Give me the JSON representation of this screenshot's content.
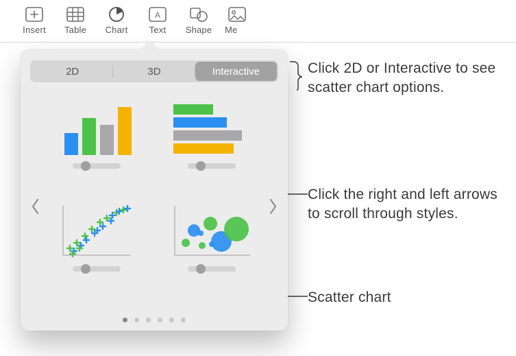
{
  "toolbar": {
    "items": [
      {
        "label": "Insert"
      },
      {
        "label": "Table"
      },
      {
        "label": "Chart"
      },
      {
        "label": "Text"
      },
      {
        "label": "Shape"
      },
      {
        "label": "Me"
      }
    ]
  },
  "popover": {
    "tabs": [
      "2D",
      "3D",
      "Interactive"
    ],
    "active_tab": "Interactive",
    "page_count": 6,
    "active_page": 0
  },
  "charts": {
    "col_bars": {
      "colors": [
        "#2b8fef",
        "#4cc24a",
        "#a8a7a9",
        "#f5b301"
      ],
      "heights": [
        32,
        54,
        44,
        70
      ]
    },
    "row_bars": {
      "colors": [
        "#4cc24a",
        "#2b8fef",
        "#a8a7a9",
        "#f5b301"
      ],
      "widths": [
        58,
        78,
        100,
        88
      ]
    },
    "scatter_points": [
      {
        "x": 8,
        "y": 66,
        "c": "#4cc24a"
      },
      {
        "x": 14,
        "y": 70,
        "c": "#2b8fef"
      },
      {
        "x": 18,
        "y": 58,
        "c": "#4cc24a"
      },
      {
        "x": 24,
        "y": 62,
        "c": "#2b8fef"
      },
      {
        "x": 30,
        "y": 48,
        "c": "#4cc24a"
      },
      {
        "x": 32,
        "y": 54,
        "c": "#2b8fef"
      },
      {
        "x": 40,
        "y": 38,
        "c": "#4cc24a"
      },
      {
        "x": 44,
        "y": 44,
        "c": "#2b8fef"
      },
      {
        "x": 52,
        "y": 28,
        "c": "#4cc24a"
      },
      {
        "x": 56,
        "y": 34,
        "c": "#2b8fef"
      },
      {
        "x": 62,
        "y": 22,
        "c": "#4cc24a"
      },
      {
        "x": 68,
        "y": 26,
        "c": "#2b8fef"
      },
      {
        "x": 76,
        "y": 14,
        "c": "#4cc24a"
      },
      {
        "x": 80,
        "y": 12,
        "c": "#2b8fef"
      },
      {
        "x": 86,
        "y": 10,
        "c": "#4cc24a"
      },
      {
        "x": 92,
        "y": 8,
        "c": "#2b8fef"
      },
      {
        "x": 12,
        "y": 74,
        "c": "#4cc24a"
      },
      {
        "x": 22,
        "y": 66,
        "c": "#4cc24a"
      },
      {
        "x": 48,
        "y": 40,
        "c": "#2b8fef"
      },
      {
        "x": 70,
        "y": 18,
        "c": "#2b8fef"
      }
    ],
    "bubbles": [
      {
        "x": 22,
        "y": 58,
        "r": 6,
        "c": "#4cc24a"
      },
      {
        "x": 34,
        "y": 40,
        "r": 9,
        "c": "#2b8fef"
      },
      {
        "x": 46,
        "y": 62,
        "r": 5,
        "c": "#4cc24a"
      },
      {
        "x": 58,
        "y": 30,
        "r": 10,
        "c": "#4cc24a"
      },
      {
        "x": 74,
        "y": 56,
        "r": 15,
        "c": "#2b8fef"
      },
      {
        "x": 96,
        "y": 38,
        "r": 18,
        "c": "#4cc24a"
      },
      {
        "x": 60,
        "y": 60,
        "r": 4,
        "c": "#2b8fef"
      },
      {
        "x": 44,
        "y": 44,
        "r": 4,
        "c": "#2b8fef"
      }
    ]
  },
  "callouts": {
    "tabs": "Click 2D or Interactive to see scatter chart options.",
    "arrows": "Click the right and left arrows to scroll through styles.",
    "scatter": "Scatter chart"
  }
}
